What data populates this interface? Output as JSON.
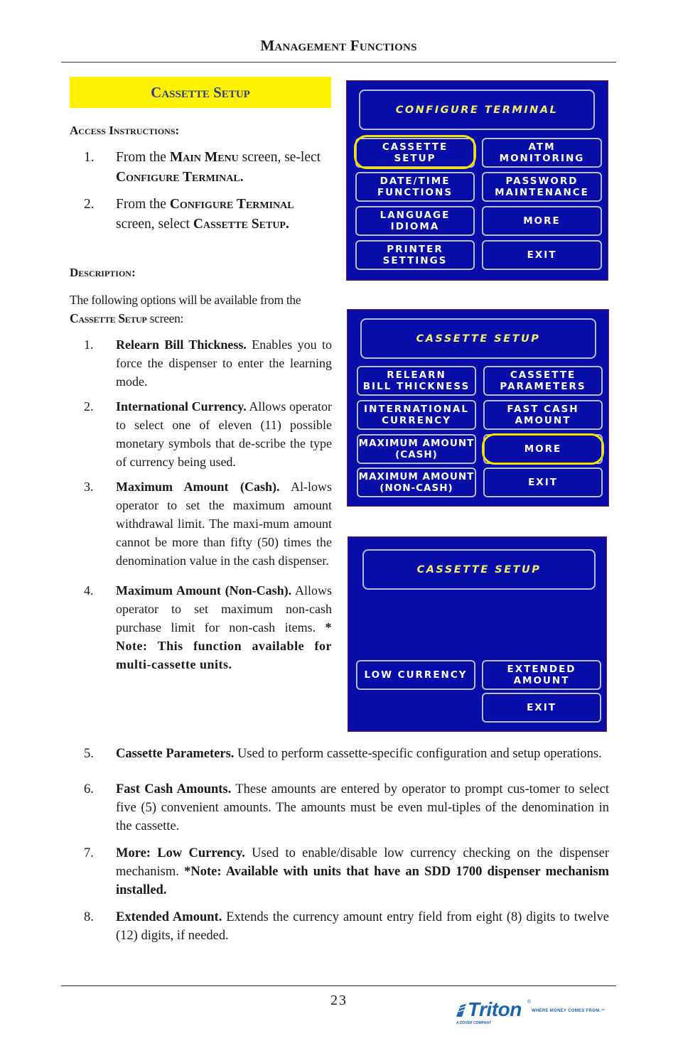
{
  "header": {
    "title": "Management Functions"
  },
  "section": {
    "title": "Cassette Setup"
  },
  "access": {
    "heading": "Access Instructions:",
    "steps": [
      {
        "num": "1.",
        "pre": "From the ",
        "sc1": "Main Menu",
        "mid": " screen, se-lect ",
        "sc2": "Configure Terminal",
        "post": "."
      },
      {
        "num": "2.",
        "pre": "From the ",
        "sc1": "Configure Terminal",
        "mid": " screen, select ",
        "sc2": "Cassette Setup",
        "post": "."
      }
    ]
  },
  "description": {
    "heading": "Description:",
    "intro_pre": "The following options will be available from the ",
    "intro_sc": "Cassette Setup",
    "intro_post": " screen:",
    "items": [
      {
        "num": "1.",
        "title": "Relearn Bill Thickness.",
        "text": " Enables you to force the dispenser to enter the learning mode."
      },
      {
        "num": "2.",
        "title": "International Currency.",
        "text": "  Allows operator to select one of eleven (11) possible monetary symbols that de-scribe the type of currency being used."
      },
      {
        "num": "3.",
        "title": "Maximum Amount (Cash).",
        "text": "  Al-lows operator to set the maximum amount withdrawal limit. The maxi-mum amount cannot be more than fifty (50) times the denomination value in the cash dispenser."
      },
      {
        "num": "4.",
        "title": "Maximum Amount (Non-Cash).",
        "text": " Allows operator to set maximum non-cash purchase limit for non-cash  items. ",
        "note": "* Note: This function available for multi-cassette units."
      },
      {
        "num": "5.",
        "title": "Cassette Parameters.",
        "text": " Used to perform cassette-specific configuration and setup operations."
      },
      {
        "num": "6.",
        "title": "Fast Cash Amounts.",
        "text": "  These amounts are entered by operator to prompt cus-tomer to select five (5) convenient amounts. The amounts must be even mul-tiples of the denomination in the cassette."
      },
      {
        "num": "7.",
        "title": "More:  Low Currency.",
        "text": " Used to enable/disable low currency checking on the dispenser mechanism. ",
        "note": "*Note: Available with units that have an SDD 1700 dispenser mechanism   installed."
      },
      {
        "num": "8.",
        "title": "Extended Amount.",
        "text": "  Extends the currency amount entry field from eight (8) digits to twelve (12) digits, if needed."
      }
    ]
  },
  "screens": [
    {
      "title": "CONFIGURE TERMINAL",
      "buttons": [
        "CASSETTE\nSETUP",
        "ATM\nMONITORING",
        "DATE/TIME\nFUNCTIONS",
        "PASSWORD\nMAINTENANCE",
        "LANGUAGE\nIDIOMA",
        "MORE",
        "PRINTER\nSETTINGS",
        "EXIT"
      ],
      "highlighted": "CASSETTE\nSETUP"
    },
    {
      "title": "CASSETTE SETUP",
      "buttons": [
        "RELEARN\nBILL THICKNESS",
        "CASSETTE\nPARAMETERS",
        "INTERNATIONAL\nCURRENCY",
        "FAST CASH\nAMOUNT",
        "MAXIMUM AMOUNT\n(CASH)",
        "MORE",
        "MAXIMUM AMOUNT\n(NON-CASH)",
        "EXIT"
      ],
      "highlighted": "MORE"
    },
    {
      "title": "CASSETTE SETUP",
      "buttons": [
        "LOW CURRENCY",
        "EXTENDED\nAMOUNT",
        "EXIT"
      ]
    }
  ],
  "colors": {
    "screen_bg": "#0a0ea8",
    "screen_title": "#f2ee6a",
    "highlight": "#f5e400",
    "section_bg": "#fff200",
    "section_text": "#2b3c8f",
    "logo": "#1e63b0"
  },
  "footer": {
    "page_number": "23",
    "logo": {
      "brand": "Triton",
      "registered": "®",
      "tagline": "WHERE MONEY COMES FROM.™",
      "sub": "A DOVER COMPANY"
    }
  }
}
